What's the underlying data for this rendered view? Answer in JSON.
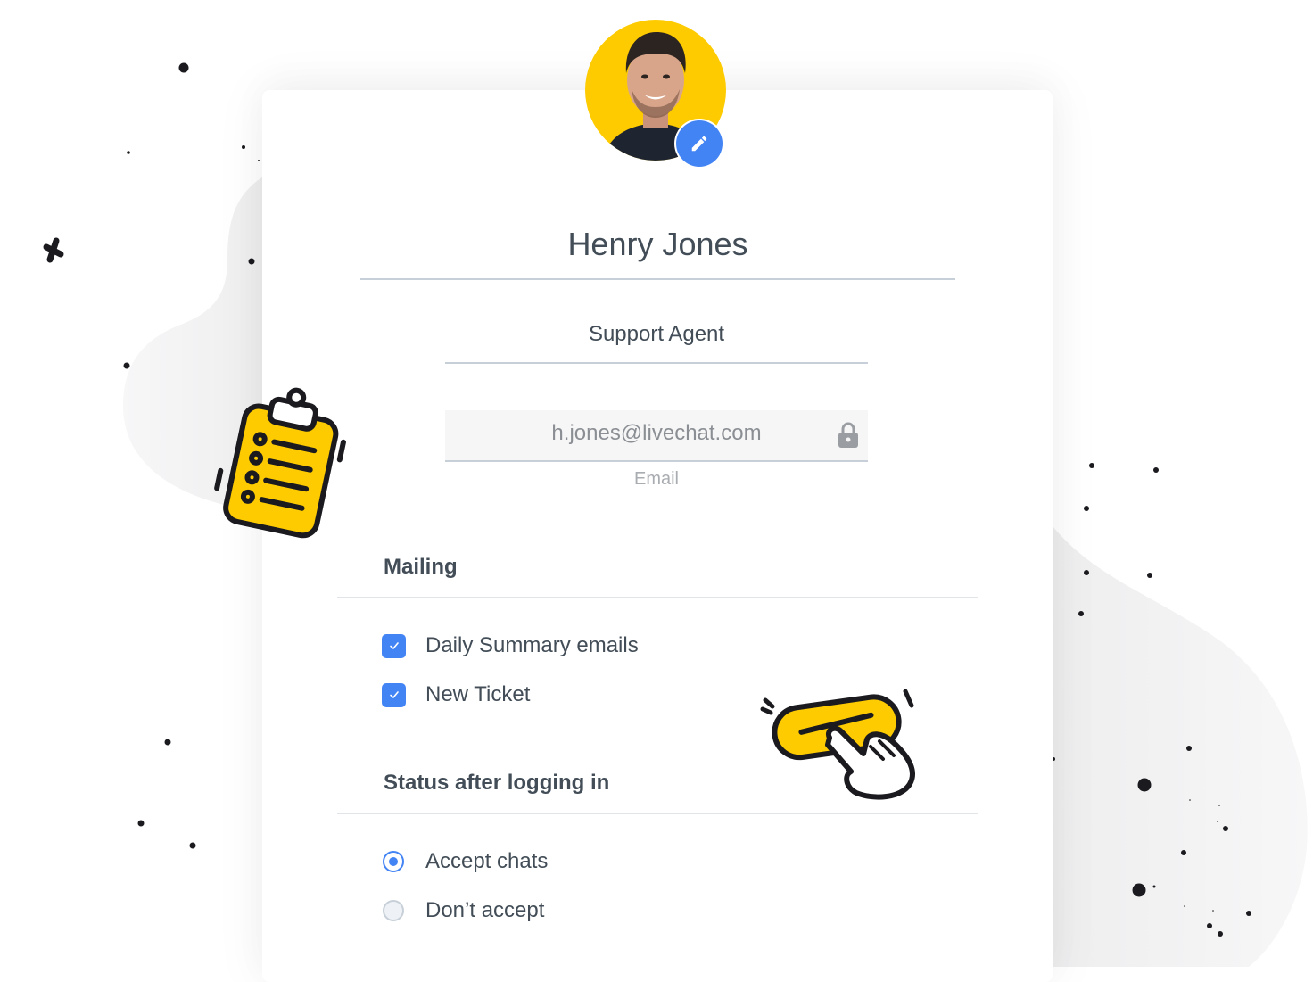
{
  "profile": {
    "name": "Henry Jones",
    "role": "Support Agent",
    "email": "h.jones@livechat.com",
    "email_label": "Email",
    "email_locked": true,
    "edit_avatar_icon": "pencil-icon"
  },
  "mailing": {
    "title": "Mailing",
    "options": [
      {
        "label": "Daily Summary emails",
        "checked": true
      },
      {
        "label": "New Ticket",
        "checked": true
      }
    ]
  },
  "status": {
    "title": "Status after logging in",
    "options": [
      {
        "label": "Accept chats",
        "selected": true
      },
      {
        "label": "Don’t accept",
        "selected": false
      }
    ]
  },
  "colors": {
    "accent": "#4384f5",
    "avatar_bg": "#fecb00",
    "text": "#424d57",
    "illustration_yellow": "#fecb00"
  },
  "decorations": [
    "clipboard-illustration",
    "button-press-illustration",
    "confetti-dots"
  ]
}
